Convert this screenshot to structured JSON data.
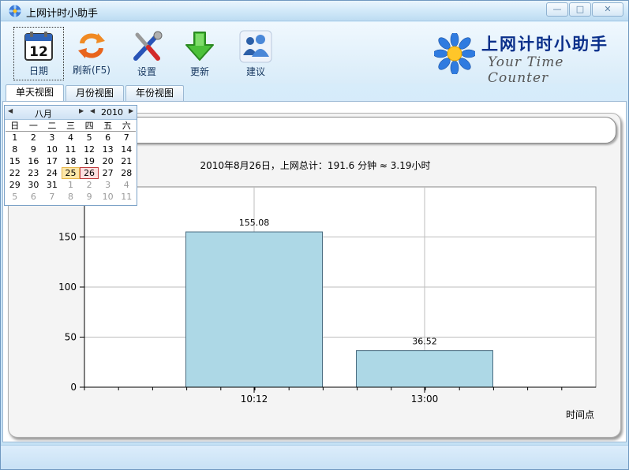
{
  "window": {
    "title": "上网计时小助手",
    "minimize_glyph": "—",
    "maximize_glyph": "□",
    "close_glyph": "✕"
  },
  "toolbar": {
    "calendar_day": "12",
    "items": [
      {
        "label": "日期",
        "icon": "calendar-icon"
      },
      {
        "label": "刷新(F5)",
        "icon": "refresh-icon"
      },
      {
        "label": "设置",
        "icon": "settings-tools-icon"
      },
      {
        "label": "更新",
        "icon": "download-arrow-icon"
      },
      {
        "label": "建议",
        "icon": "users-icon"
      }
    ]
  },
  "brand": {
    "title_cn": "上网计时小助手",
    "title_en": "Your Time Counter"
  },
  "tabs": [
    {
      "label": "单天视图",
      "active": true
    },
    {
      "label": "月份视图",
      "active": false
    },
    {
      "label": "年份视图",
      "active": false
    }
  ],
  "calendar": {
    "month": "八月",
    "year": "2010",
    "weekdays": [
      "日",
      "一",
      "二",
      "三",
      "四",
      "五",
      "六"
    ],
    "days": [
      [
        "1",
        "2",
        "3",
        "4",
        "5",
        "6",
        "7"
      ],
      [
        "8",
        "9",
        "10",
        "11",
        "12",
        "13",
        "14"
      ],
      [
        "15",
        "16",
        "17",
        "18",
        "19",
        "20",
        "21"
      ],
      [
        "22",
        "23",
        "24",
        "25",
        "26",
        "27",
        "28"
      ],
      [
        "29",
        "30",
        "31",
        "1",
        "2",
        "3",
        "4"
      ],
      [
        "5",
        "6",
        "7",
        "8",
        "9",
        "10",
        "11"
      ]
    ],
    "today": "25",
    "selected": "26"
  },
  "summary": "2010年8月26日，上网总计：191.6 分钟 ≈ 3.19小时",
  "chart_data": {
    "type": "bar",
    "categories": [
      "10:12",
      "13:00"
    ],
    "values": [
      155.08,
      36.52
    ],
    "value_labels": [
      "155.08",
      "36.52"
    ],
    "xlabel": "时间点",
    "ylabel": "",
    "ylim": [
      0,
      200
    ],
    "yticks": [
      "0",
      "50",
      "100",
      "150"
    ],
    "grid": true,
    "bar_color": "#add8e6",
    "bar_edge": "#4a6c80"
  },
  "colors": {
    "accent": "#0a2f8a",
    "bar": "#add8e6"
  }
}
